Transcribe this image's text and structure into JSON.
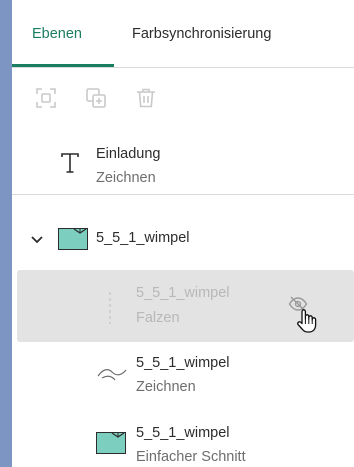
{
  "tabs": [
    {
      "label": "Ebenen",
      "active": true
    },
    {
      "label": "Farbsynchronisierung",
      "active": false
    }
  ],
  "toolbar": {
    "icons": [
      "focus-icon",
      "duplicate-icon",
      "trash-icon"
    ],
    "enabled": false
  },
  "layers": [
    {
      "name": "Einladung",
      "type": "Zeichnen",
      "icon": "text-icon"
    },
    {
      "name": "5_5_1_wimpel",
      "type": "",
      "icon": "image-thumbnail-icon",
      "expanded": true
    },
    {
      "name": "5_5_1_wimpel",
      "type": "Falzen",
      "icon": "fold-line-icon",
      "selected": true,
      "hidden": true
    },
    {
      "name": "5_5_1_wimpel",
      "type": "Zeichnen",
      "icon": "draw-path-icon"
    },
    {
      "name": "5_5_1_wimpel",
      "type": "Einfacher Schnitt",
      "icon": "image-thumbnail-icon"
    }
  ],
  "colors": {
    "accent": "#1a7e62",
    "background": "#7d95c2",
    "selected_row": "#e3e3e3",
    "thumbnail": "#7ccfbf"
  }
}
